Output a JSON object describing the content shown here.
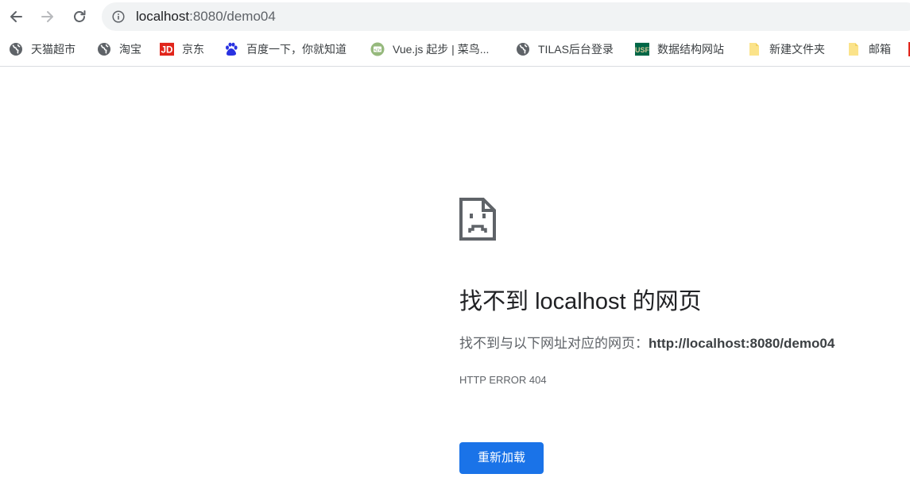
{
  "toolbar": {
    "url_host": "localhost",
    "url_path": ":8080/demo04"
  },
  "bookmarks": [
    {
      "label": "天猫超市",
      "icon": "globe-icon"
    },
    {
      "label": "淘宝",
      "icon": "globe-icon"
    },
    {
      "label": "京东",
      "icon": "jd-logo-icon"
    },
    {
      "label": "百度一下，你就知道",
      "icon": "baidu-paw-icon"
    },
    {
      "label": "Vue.js 起步 | 菜鸟...",
      "icon": "runoob-icon"
    },
    {
      "label": "TILAS后台登录",
      "icon": "globe-icon"
    },
    {
      "label": "数据结构网站",
      "icon": "usf-logo-icon"
    },
    {
      "label": "新建文件夹",
      "icon": "folder-icon"
    },
    {
      "label": "邮箱",
      "icon": "folder-icon"
    }
  ],
  "error": {
    "title_pre": "找不到 ",
    "title_host": "localhost",
    "title_post": " 的网页",
    "desc_prefix": "找不到与以下网址对应的网页：",
    "desc_url": "http://localhost:8080/demo04",
    "code": "HTTP ERROR 404",
    "reload_label": "重新加载"
  },
  "colors": {
    "accent": "#1a73e8",
    "omnibox_bg": "#f1f3f4",
    "text_primary": "#202124",
    "text_secondary": "#5f6368"
  }
}
